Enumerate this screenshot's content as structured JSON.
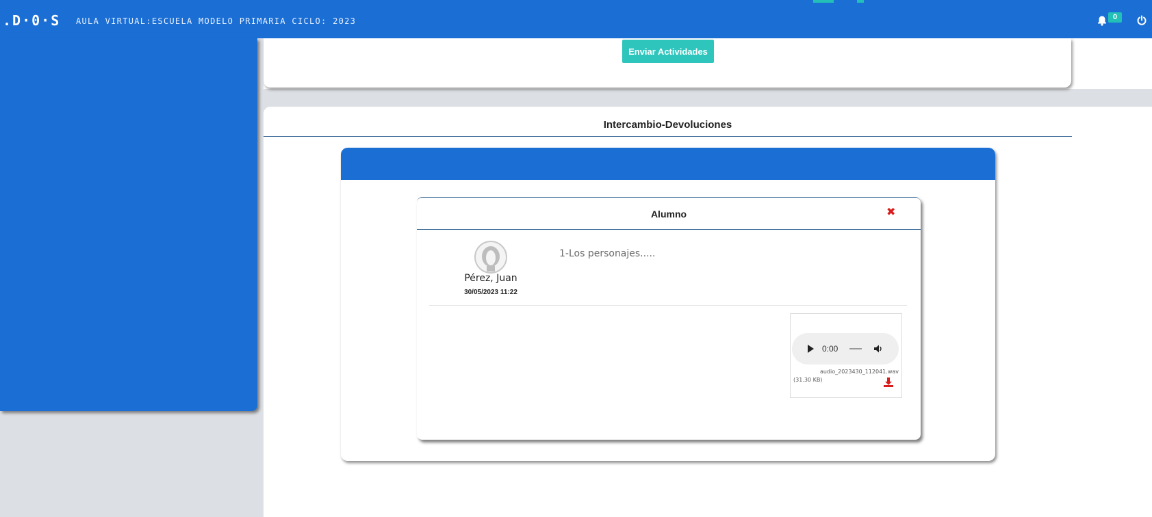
{
  "header": {
    "logo": ".D·0·S",
    "course_title": "AULA VIRTUAL:ESCUELA MODELO PRIMARIA CICLO: 2023",
    "notification_count": "0",
    "icons": {
      "notifications": "bell-icon",
      "logout": "power-icon"
    }
  },
  "top_card": {
    "send_button_label": "Enviar Actividades"
  },
  "section": {
    "title": "Intercambio-Devoluciones"
  },
  "modal": {
    "title": "Alumno",
    "close_icon": "close-icon",
    "message": {
      "student_name": "Pérez, Juan",
      "date": "30/05/2023 11:22",
      "text": "1-Los personajes.....",
      "attachment": {
        "time": "0:00",
        "file_name": "audio_2023430_112041.wav",
        "file_size": "(31.30 KB)"
      }
    }
  },
  "colors": {
    "primary_blue": "#1b6fd4",
    "accent_teal": "#2ec5bd",
    "close_red": "#d91c1c",
    "background_gray": "#dcdfe3"
  }
}
